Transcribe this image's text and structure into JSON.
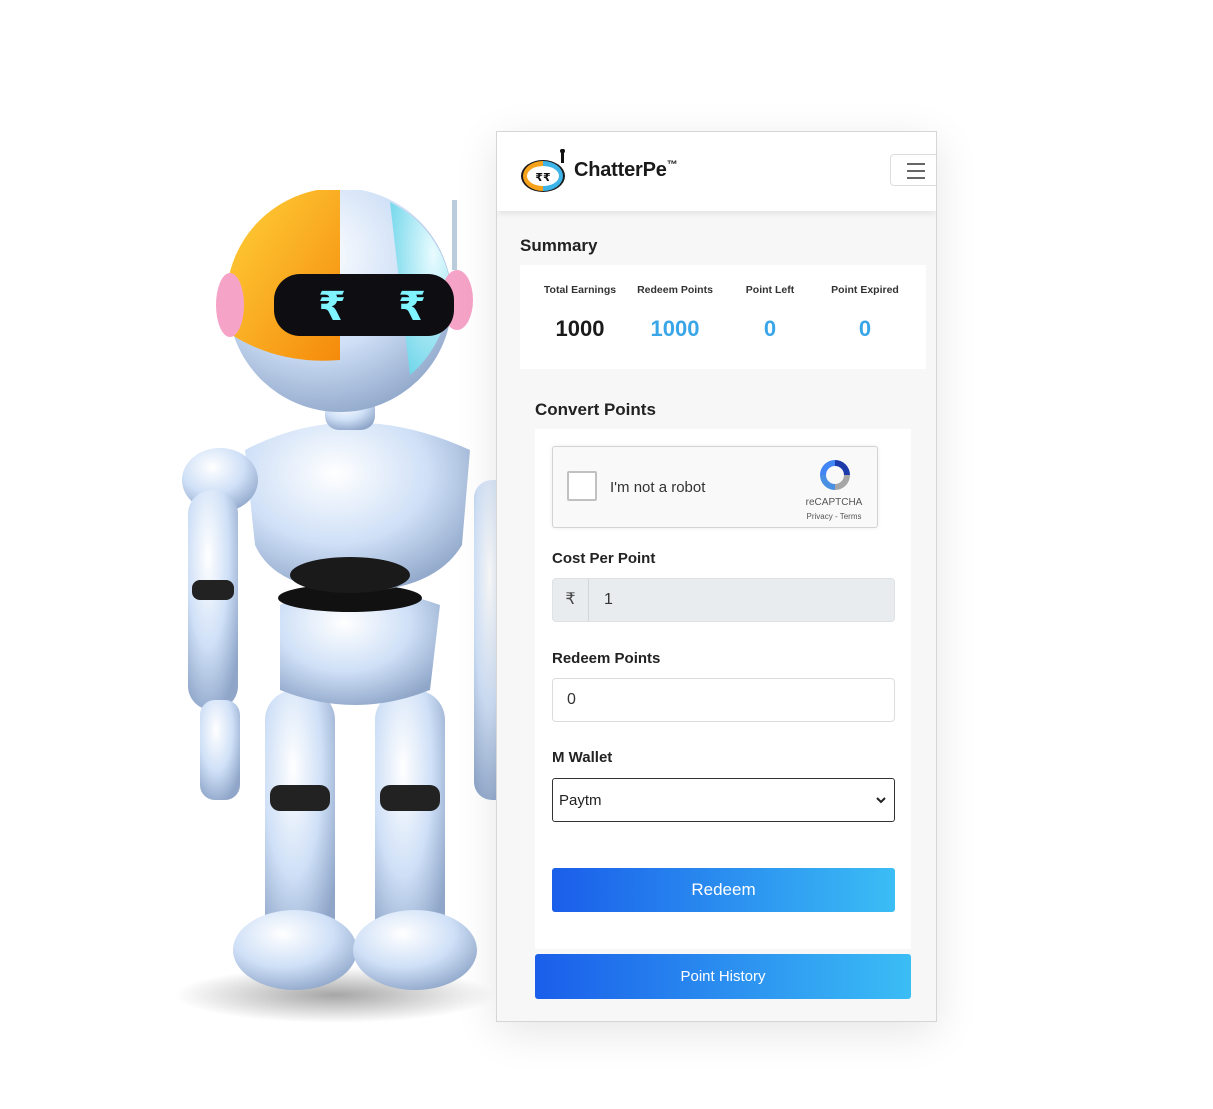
{
  "header": {
    "brand_name": "ChatterPe",
    "brand_mark": "™",
    "logo_icon": "chatterpe-robot-logo",
    "menu_icon": "hamburger-menu-icon"
  },
  "summary": {
    "title": "Summary",
    "items": [
      {
        "label": "Total Earnings",
        "value": "1000"
      },
      {
        "label": "Redeem Points",
        "value": "1000"
      },
      {
        "label": "Point Left",
        "value": "0"
      },
      {
        "label": "Point Expired",
        "value": "0"
      }
    ]
  },
  "convert": {
    "title": "Convert Points",
    "captcha": {
      "label": "I'm not a robot",
      "brand": "reCAPTCHA",
      "links": "Privacy - Terms"
    },
    "cost_per_point": {
      "label": "Cost Per Point",
      "currency": "₹",
      "value": "1"
    },
    "redeem_points": {
      "label": "Redeem Points",
      "value": "0"
    },
    "wallet": {
      "label": "M Wallet",
      "selected": "Paytm"
    },
    "redeem_button": "Redeem"
  },
  "point_history_button": "Point History",
  "colors": {
    "accent_blue": "#3aa6e8",
    "button_gradient_start": "#1a5eea",
    "button_gradient_end": "#3bbdf5"
  }
}
